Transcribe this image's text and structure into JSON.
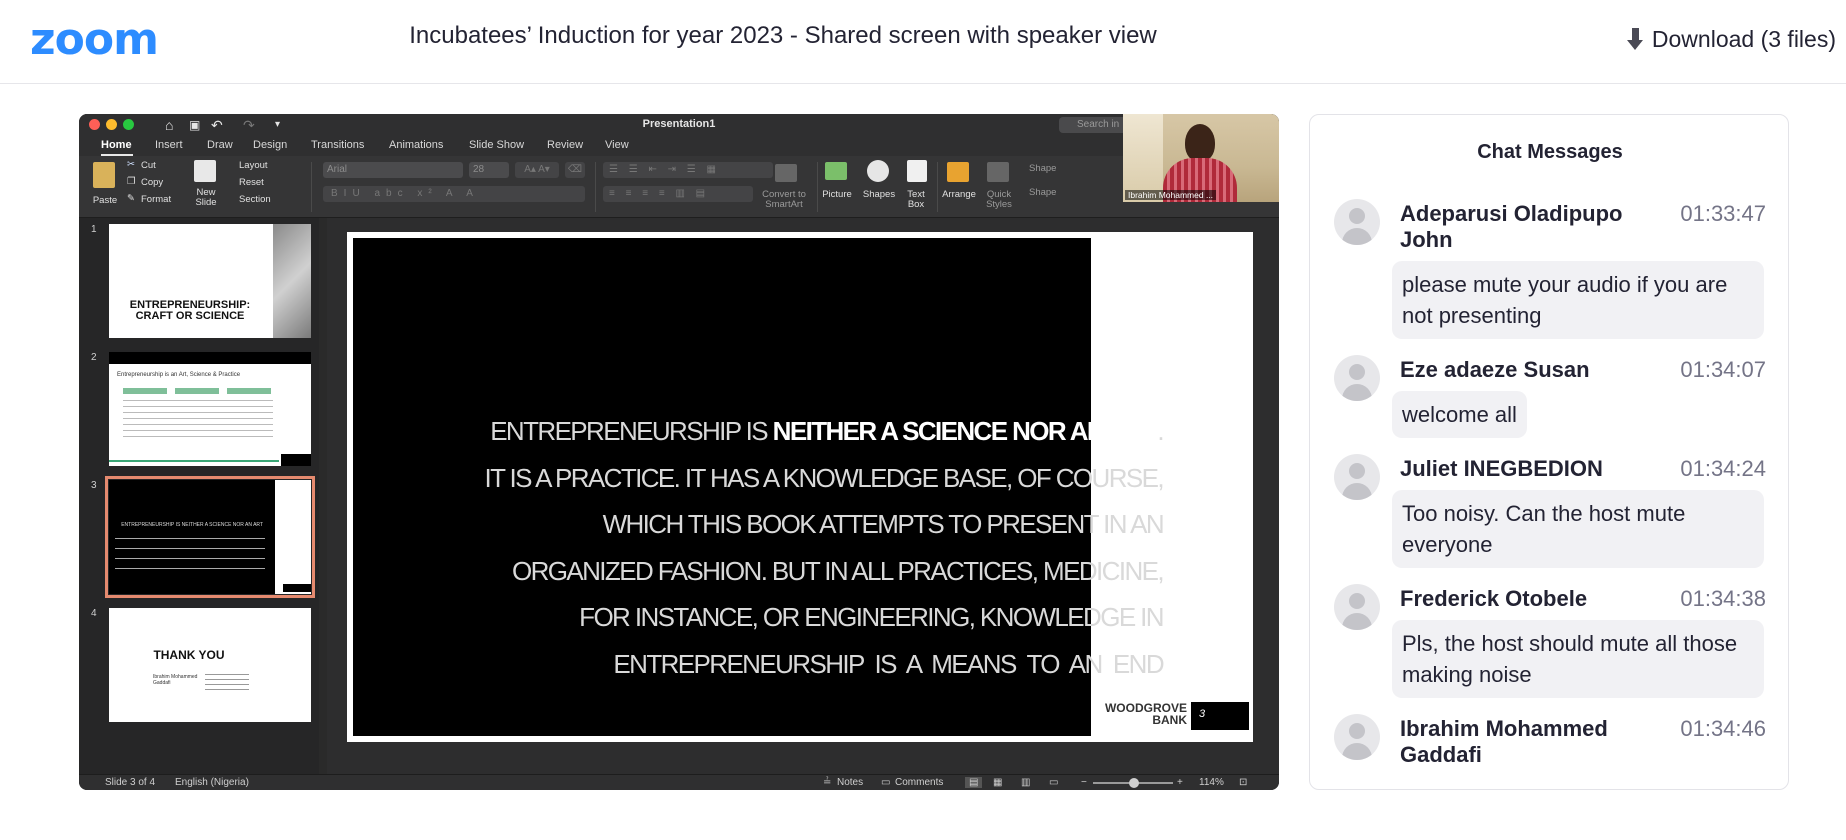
{
  "header": {
    "logo": "zoom",
    "recording_title": "Incubatees’ Induction for year 2023 - Shared screen with speaker view",
    "download_label": "Download (3 files)"
  },
  "powerpoint": {
    "window_title": "Presentation1",
    "search_placeholder": "Search in",
    "tabs": [
      "Home",
      "Insert",
      "Draw",
      "Design",
      "Transitions",
      "Animations",
      "Slide Show",
      "Review",
      "View"
    ],
    "ribbon": {
      "paste": "Paste",
      "cut": "Cut",
      "copy": "Copy",
      "format": "Format",
      "new_slide": "New Slide",
      "layout": "Layout",
      "reset": "Reset",
      "section": "Section",
      "font_name": "Arial",
      "font_size": "28",
      "convert_smartart": "Convert to SmartArt",
      "picture": "Picture",
      "shapes": "Shapes",
      "text_box": "Text Box",
      "arrange": "Arrange",
      "quick_styles": "Quick Styles",
      "shape_fill": "Shape",
      "shape_outline": "Shape"
    },
    "speaker_name": "Ibrahim Mohammed ...",
    "thumbnails": [
      {
        "num": "1",
        "title": "ENTREPRENEURSHIP: CRAFT OR SCIENCE"
      },
      {
        "num": "2",
        "title": "Entrepreneurship is an Art, Science & Practice"
      },
      {
        "num": "3",
        "title": "ENTREPRENEURSHIP IS NEITHER A SCIENCE NOR AN ART"
      },
      {
        "num": "4",
        "title": "THANK YOU",
        "sub": "Ibrahim Mohammed Gaddafi"
      }
    ],
    "slide": {
      "line1_normal": "ENTREPRENEURSHIP IS ",
      "line1_bold": "NEITHER A SCIENCE NOR AN ART",
      "line1_end": ".",
      "line2": "IT IS A PRACTICE. IT HAS A KNOWLEDGE BASE, OF COURSE,",
      "line3": "WHICH THIS BOOK ATTEMPTS TO PRESENT IN AN",
      "line4": "ORGANIZED FASHION. BUT IN ALL PRACTICES, MEDICINE,",
      "line5": "FOR INSTANCE, OR ENGINEERING, KNOWLEDGE IN",
      "line6": "ENTREPRENEURSHIP  IS  A  MEANS  TO  AN  END",
      "brand_line1": "WOODGROVE",
      "brand_line2": "BANK",
      "page_number": "3"
    },
    "status": {
      "slide_counter": "Slide 3 of 4",
      "language": "English (Nigeria)",
      "notes": "Notes",
      "comments": "Comments",
      "zoom": "114%"
    }
  },
  "chat": {
    "title": "Chat Messages",
    "messages": [
      {
        "sender": "Adeparusi Oladipupo John",
        "time": "01:33:47",
        "text": "please mute your audio if you are not presenting"
      },
      {
        "sender": "Eze adaeze Susan",
        "time": "01:34:07",
        "text": "welcome all"
      },
      {
        "sender": "Juliet INEGBEDION",
        "time": "01:34:24",
        "text": "Too noisy. Can the host mute everyone"
      },
      {
        "sender": "Frederick Otobele",
        "time": "01:34:38",
        "text": "Pls, the host should mute all those making noise"
      },
      {
        "sender": "Ibrahim Mohammed Gaddafi",
        "time": "01:34:46",
        "text": ""
      }
    ]
  },
  "colors": {
    "zoom_blue": "#2d8cff",
    "selected_thumb_outline": "#e58a6f",
    "bubble_bg": "#f1f1f4"
  }
}
